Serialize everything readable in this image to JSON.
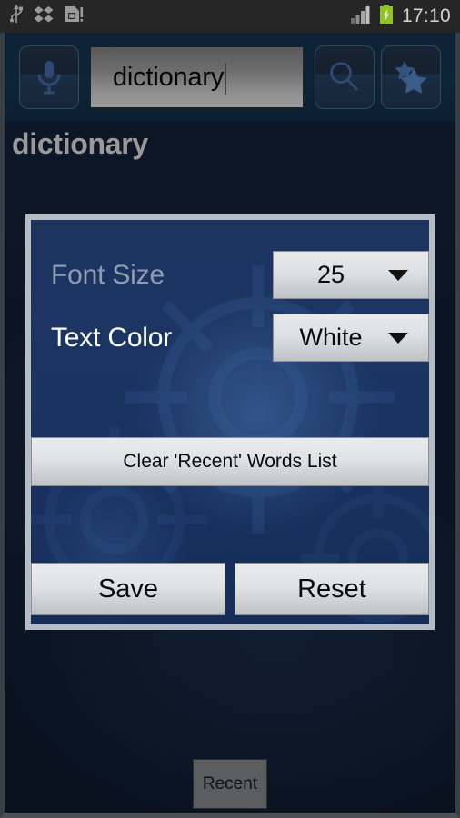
{
  "statusbar": {
    "time": "17:10",
    "icons": [
      "usb-icon",
      "dropbox-icon",
      "sim-card-alert-icon",
      "signal-bars-icon",
      "battery-charging-icon"
    ]
  },
  "toolbar": {
    "mic_button_label": "",
    "mic_icon": "microphone-icon",
    "search_input_value": "dictionary",
    "search_input_placeholder": "",
    "search_button_icon": "magnifier-icon",
    "favorites_button_icon": "star-icon"
  },
  "page": {
    "title": "dictionary"
  },
  "settings": {
    "rows": [
      {
        "label": "Font Size",
        "value": "25",
        "state": "muted"
      },
      {
        "label": "Text Color",
        "value": "White",
        "state": "active"
      }
    ],
    "clear_recent_label": "Clear 'Recent' Words List",
    "save_label": "Save",
    "reset_label": "Reset"
  },
  "footer": {
    "recent_label": "Recent"
  },
  "colors": {
    "panel_blue": "#1d3460",
    "panel_border": "#b6bcc4",
    "toolbar_navy": "#0d2538",
    "app_bg": "#0b1422",
    "status_bg": "#262626",
    "battery_green": "#8ec321",
    "title_gray": "#9a9a9a",
    "button_face": "#e1e2e4"
  }
}
